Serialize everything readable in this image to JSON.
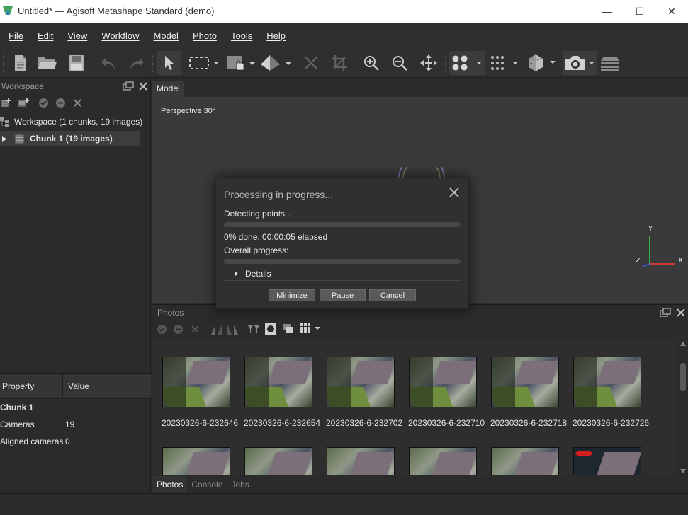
{
  "window": {
    "title": "Untitled* — Agisoft Metashape Standard (demo)",
    "minimize_glyph": "—",
    "maximize_glyph": "☐",
    "close_glyph": "✕"
  },
  "menu": [
    "File",
    "Edit",
    "View",
    "Workflow",
    "Model",
    "Photo",
    "Tools",
    "Help"
  ],
  "toolbar_icons": [
    "new-icon",
    "open-icon",
    "save-icon",
    "undo-icon",
    "redo-icon",
    "select-icon",
    "rect-select-icon",
    "navigation-icon",
    "ruler-icon",
    "delete-icon",
    "crop-icon",
    "zoom-in-icon",
    "zoom-out-icon",
    "reset-view-icon",
    "point-cloud-icon",
    "dense-points-icon",
    "model-icon",
    "camera-icon",
    "layers-icon"
  ],
  "workspace": {
    "panel_title": "Workspace",
    "root_label": "Workspace (1 chunks, 19 images)",
    "chunk_label": "Chunk 1 (19 images)"
  },
  "properties": {
    "col_property": "Property",
    "col_value": "Value",
    "rows": [
      {
        "property": "Chunk 1",
        "value": ""
      },
      {
        "property": "Cameras",
        "value": "19"
      },
      {
        "property": "Aligned cameras",
        "value": "0"
      }
    ]
  },
  "model": {
    "tab_label": "Model",
    "perspective": "Perspective 30°",
    "axis_x": "X",
    "axis_y": "Y",
    "axis_z": "Z"
  },
  "photos": {
    "panel_title": "Photos",
    "items": [
      "20230326-6-232646",
      "20230326-6-232654",
      "20230326-6-232702",
      "20230326-6-232710",
      "20230326-6-232718",
      "20230326-6-232726"
    ],
    "bottom_tabs": [
      "Photos",
      "Console",
      "Jobs"
    ]
  },
  "dialog": {
    "title": "Processing in progress...",
    "step": "Detecting points...",
    "step_progress": 0,
    "status": "0% done, 00:00:05 elapsed",
    "overall_label": "Overall progress:",
    "overall_progress": 0,
    "details_label": "Details",
    "buttons": {
      "minimize": "Minimize",
      "pause": "Pause",
      "cancel": "Cancel"
    }
  },
  "colors": {
    "accent": "#4e8fd6",
    "axis_x": "#d23a3a",
    "axis_y": "#3ab04a",
    "axis_z": "#3a5ad2"
  }
}
